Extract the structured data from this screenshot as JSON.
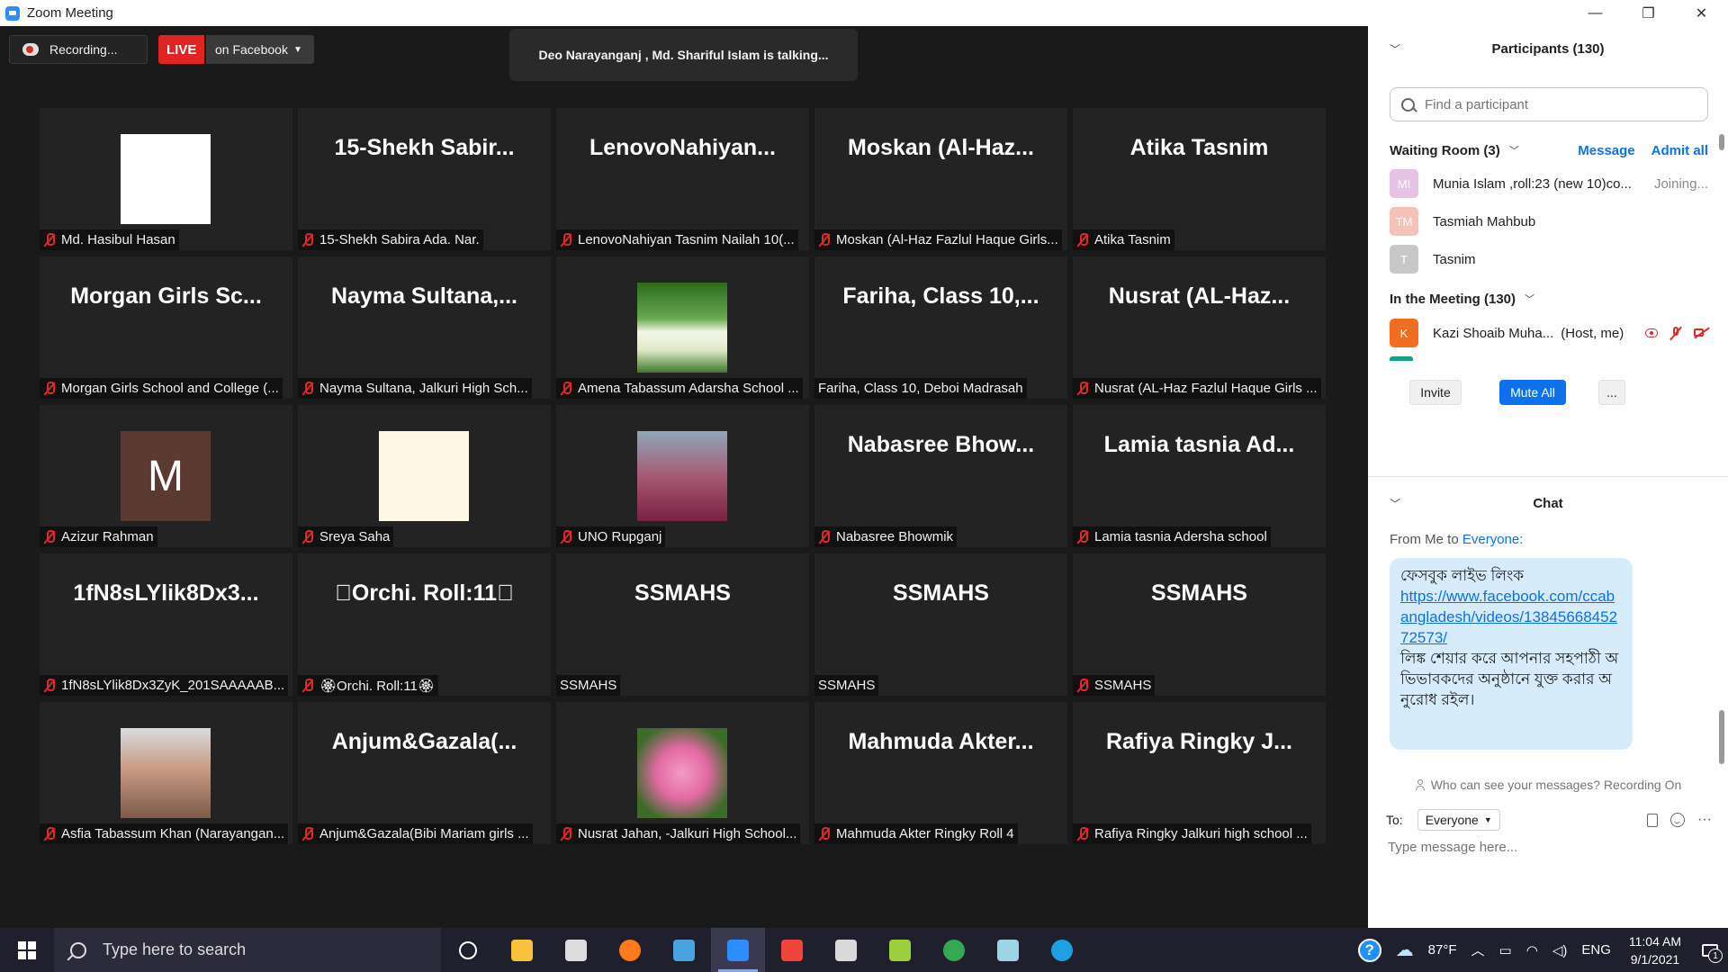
{
  "window": {
    "title": "Zoom Meeting",
    "controls": [
      "—",
      "❐",
      "✕"
    ]
  },
  "meeting_bar": {
    "recording_label": "Recording...",
    "live_label": "LIVE",
    "live_target": "on Facebook",
    "talking": "Deo Narayanganj , Md. Shariful Islam is talking..."
  },
  "tiles": [
    {
      "big": "",
      "name": "Md. Hasibul Hasan",
      "pic": "pic-avatar-man",
      "muted": true
    },
    {
      "big": "15-Shekh Sabir...",
      "name": "15-Shekh Sabira Ada. Nar.",
      "pic": "",
      "muted": true
    },
    {
      "big": "LenovoNahiyan...",
      "name": "LenovoNahiyan Tasnim Nailah 10(...",
      "pic": "",
      "muted": true
    },
    {
      "big": "Moskan (Al-Haz...",
      "name": "Moskan (Al-Haz Fazlul Haque Girls...",
      "pic": "",
      "muted": true
    },
    {
      "big": "Atika Tasnim",
      "name": "Atika Tasnim",
      "pic": "",
      "muted": true
    },
    {
      "big": "Morgan Girls Sc...",
      "name": "Morgan Girls School and College (...",
      "pic": "",
      "muted": true
    },
    {
      "big": "Nayma Sultana,...",
      "name": "Nayma Sultana, Jalkuri High Sch...",
      "pic": "",
      "muted": true
    },
    {
      "big": "",
      "name": "Amena Tabassum Adarsha School ...",
      "pic": "pic-tulip",
      "muted": true
    },
    {
      "big": "Fariha, Class 10,...",
      "name": "Fariha, Class 10, Deboi Madrasah",
      "pic": "",
      "muted": false
    },
    {
      "big": "Nusrat (AL-Haz...",
      "name": "Nusrat (AL-Haz Fazlul Haque Girls ...",
      "pic": "",
      "muted": true
    },
    {
      "big": "",
      "name": "Azizur Rahman",
      "pic": "pic-m",
      "letter": "M",
      "muted": true
    },
    {
      "big": "",
      "name": "Sreya Saha",
      "pic": "pic-anime",
      "muted": true
    },
    {
      "big": "",
      "name": "UNO Rupganj",
      "pic": "pic-woman",
      "muted": true
    },
    {
      "big": "Nabasree Bhow...",
      "name": "Nabasree Bhowmik",
      "pic": "",
      "muted": true
    },
    {
      "big": "Lamia tasnia Ad...",
      "name": "Lamia tasnia Adersha school",
      "pic": "",
      "muted": true
    },
    {
      "big": "1fN8sLYlik8Dx3...",
      "name": "1fN8sLYlik8Dx3ZyK_201SAAAAAB...",
      "pic": "",
      "muted": true
    },
    {
      "big": "􏿽Orchi. Roll:11􏿽",
      "name": "🏵Orchi. Roll:11🏵",
      "pic": "",
      "muted": true
    },
    {
      "big": "SSMAHS",
      "name": "SSMAHS",
      "pic": "",
      "muted": false
    },
    {
      "big": "SSMAHS",
      "name": "SSMAHS",
      "pic": "",
      "muted": false
    },
    {
      "big": "SSMAHS",
      "name": "SSMAHS",
      "pic": "",
      "muted": true
    },
    {
      "big": "",
      "name": "Asfia Tabassum Khan (Narayangan...",
      "pic": "pic-girl",
      "muted": true
    },
    {
      "big": "Anjum&Gazala(...",
      "name": "Anjum&Gazala(Bibi Mariam girls ...",
      "pic": "",
      "muted": true
    },
    {
      "big": "",
      "name": "Nusrat Jahan, -Jalkuri High School...",
      "pic": "pic-flower",
      "muted": true
    },
    {
      "big": "Mahmuda Akter...",
      "name": "Mahmuda Akter Ringky Roll 4",
      "pic": "",
      "muted": true
    },
    {
      "big": "Rafiya Ringky J...",
      "name": "Rafiya Ringky Jalkuri high school ...",
      "pic": "",
      "muted": true
    }
  ],
  "participants": {
    "title": "Participants (130)",
    "search_placeholder": "Find a participant",
    "waiting_room_label": "Waiting Room (3)",
    "message_label": "Message",
    "admit_all_label": "Admit all",
    "waiting": [
      {
        "initials": "MI",
        "name": "Munia Islam ,roll:23 (new 10)co...",
        "status": "Joining...",
        "color": "#e7c3e6"
      },
      {
        "initials": "TM",
        "name": "Tasmiah Mahbub",
        "status": "",
        "color": "#f4c2b7"
      },
      {
        "initials": "T",
        "name": "Tasnim",
        "status": "",
        "color": "#c7c7c7"
      }
    ],
    "in_meeting_label": "In the Meeting (130)",
    "host": {
      "initials": "K",
      "name": "Kazi Shoaib Muha...",
      "role": "(Host, me)",
      "color": "#f26d21"
    },
    "invite_label": "Invite",
    "mute_all_label": "Mute All",
    "more_label": "..."
  },
  "chat": {
    "title": "Chat",
    "from_prefix": "From Me to",
    "from_target": "Everyone:",
    "message_line1": "ফেসবুক লাইভ লিংক",
    "message_url": "https://www.facebook.com/ccabangladesh/videos/1384566845272573/",
    "message_line2": "লিঙ্ক শেয়ার করে আপনার সহপাঠী অভিভাবকদের অনুষ্ঠানে যুক্ত করার অনুরোধ রইল।",
    "privacy": "Who can see your messages? Recording On",
    "to_label": "To:",
    "to_value": "Everyone",
    "input_placeholder": "Type message here...",
    "more_icon": "···"
  },
  "taskbar": {
    "search_placeholder": "Type here to search",
    "apps": [
      {
        "name": "cortana",
        "color": "#ffffff",
        "active": false
      },
      {
        "name": "file-explorer",
        "color": "#f8c23a",
        "active": false
      },
      {
        "name": "store",
        "color": "#dddddd",
        "active": false
      },
      {
        "name": "firefox",
        "color": "#ff7a1a",
        "active": false
      },
      {
        "name": "infinity",
        "color": "#4aa3df",
        "active": false
      },
      {
        "name": "zoom",
        "color": "#2d8cff",
        "active": true
      },
      {
        "name": "anydesk",
        "color": "#ef443b",
        "active": false
      },
      {
        "name": "paint",
        "color": "#d9d9d9",
        "active": false
      },
      {
        "name": "photo-app",
        "color": "#9ccf3e",
        "active": false
      },
      {
        "name": "chrome",
        "color": "#34a853",
        "active": false
      },
      {
        "name": "notepad",
        "color": "#9fd3e6",
        "active": false
      },
      {
        "name": "edge",
        "color": "#1fa0e3",
        "active": false
      }
    ],
    "weather": "87°F",
    "lang": "ENG",
    "time": "11:04 AM",
    "date": "9/1/2021",
    "notif_count": "1"
  }
}
